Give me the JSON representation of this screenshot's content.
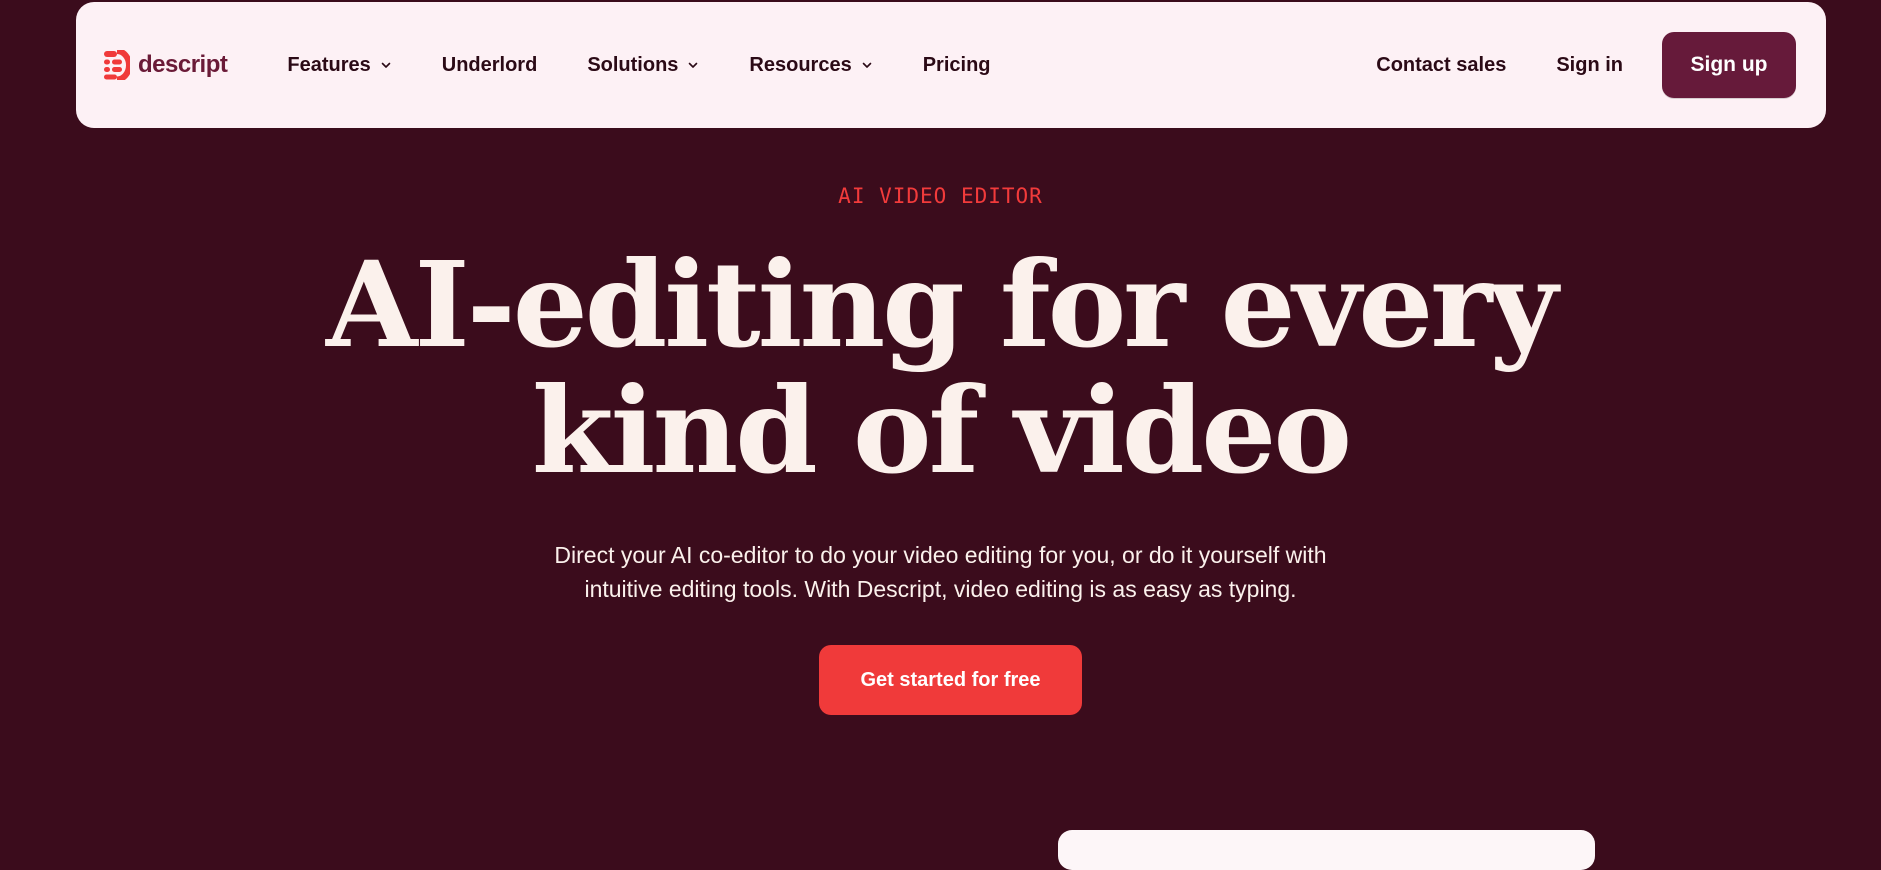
{
  "brand": {
    "name": "descript",
    "logo_icon": "descript-logo-icon",
    "color": "#6a1a37"
  },
  "nav": {
    "items": [
      {
        "label": "Features",
        "has_dropdown": true
      },
      {
        "label": "Underlord",
        "has_dropdown": false
      },
      {
        "label": "Solutions",
        "has_dropdown": true
      },
      {
        "label": "Resources",
        "has_dropdown": true
      },
      {
        "label": "Pricing",
        "has_dropdown": false
      }
    ],
    "contact_sales": "Contact sales",
    "sign_in": "Sign in",
    "sign_up": "Sign up"
  },
  "hero": {
    "eyebrow": "AI VIDEO EDITOR",
    "headline_line1": "AI-editing for every",
    "headline_line2": "kind of video",
    "subtitle_line1": "Direct your AI co-editor to do your video editing for you, or do it yourself with",
    "subtitle_line2": "intuitive editing tools. With Descript, video editing is as easy as typing.",
    "cta": "Get started for free"
  },
  "colors": {
    "background": "#3b0c1c",
    "nav_background": "#fdf1f5",
    "accent": "#f03a3a",
    "signup_button": "#661a3a",
    "headline_text": "#fbf1ec"
  }
}
